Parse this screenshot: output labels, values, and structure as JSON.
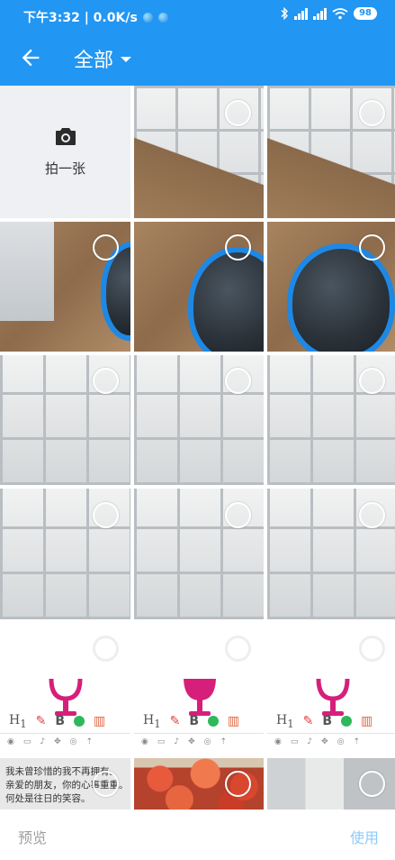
{
  "status_bar": {
    "time_speed": "下午3:32 | 0.0K/s",
    "battery": "98"
  },
  "app_bar": {
    "title": "全部"
  },
  "camera_tile": {
    "label": "拍一张"
  },
  "text_thumbnail": {
    "lines": [
      "我未曾珍惜的我不再拥有。",
      "亲爱的朋友，你的心事重重。",
      "何处是往日的笑容。"
    ]
  },
  "bottom_bar": {
    "preview_label": "预览",
    "use_label": "使用"
  },
  "colors": {
    "primary": "#2196f3",
    "disabled_text": "#9e9e9e",
    "use_disabled": "#90caf9",
    "magenta": "#d61f7a"
  }
}
